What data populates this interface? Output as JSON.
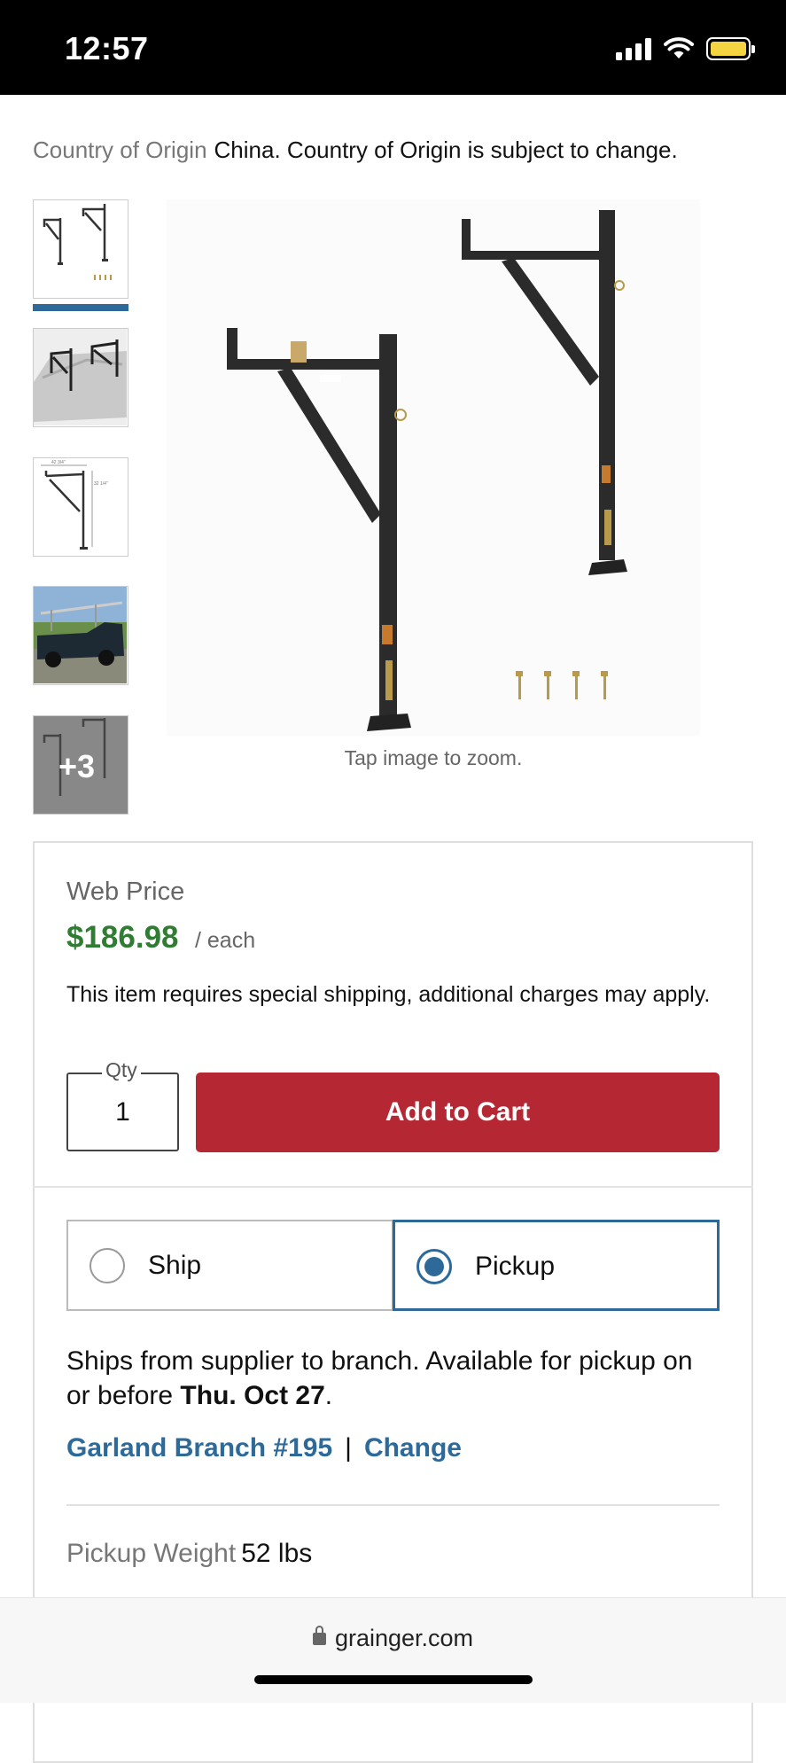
{
  "status_bar": {
    "time": "12:57",
    "battery_color": "#f5d442"
  },
  "origin": {
    "label": "Country of Origin",
    "value": "China. Country of Origin is subject to change."
  },
  "gallery": {
    "thumbnails": [
      "product-front-view",
      "product-on-truck-bed",
      "product-dimensions-drawing",
      "product-on-truck-photo"
    ],
    "more_label": "+3",
    "active_index": 0,
    "zoom_hint": "Tap image to zoom."
  },
  "price_panel": {
    "web_price_label": "Web Price",
    "price": "$186.98",
    "unit": "/ each",
    "shipping_note": "This item requires special shipping, additional charges may apply.",
    "qty_label": "Qty",
    "qty_value": "1",
    "add_to_cart": "Add to Cart",
    "price_color": "#2f7d32",
    "cart_color": "#b52833"
  },
  "fulfillment": {
    "options": [
      {
        "label": "Ship",
        "selected": false
      },
      {
        "label": "Pickup",
        "selected": true
      }
    ],
    "info_text": "Ships from supplier to branch. Available for pickup on or before ",
    "info_date": "Thu. Oct 27",
    "info_end": ".",
    "branch": "Garland Branch #195",
    "separator": "|",
    "change_label": "Change",
    "weight_label": "Pickup Weight",
    "weight_value": "52 lbs",
    "accent_color": "#2e6a99"
  },
  "browser": {
    "url": "grainger.com"
  }
}
